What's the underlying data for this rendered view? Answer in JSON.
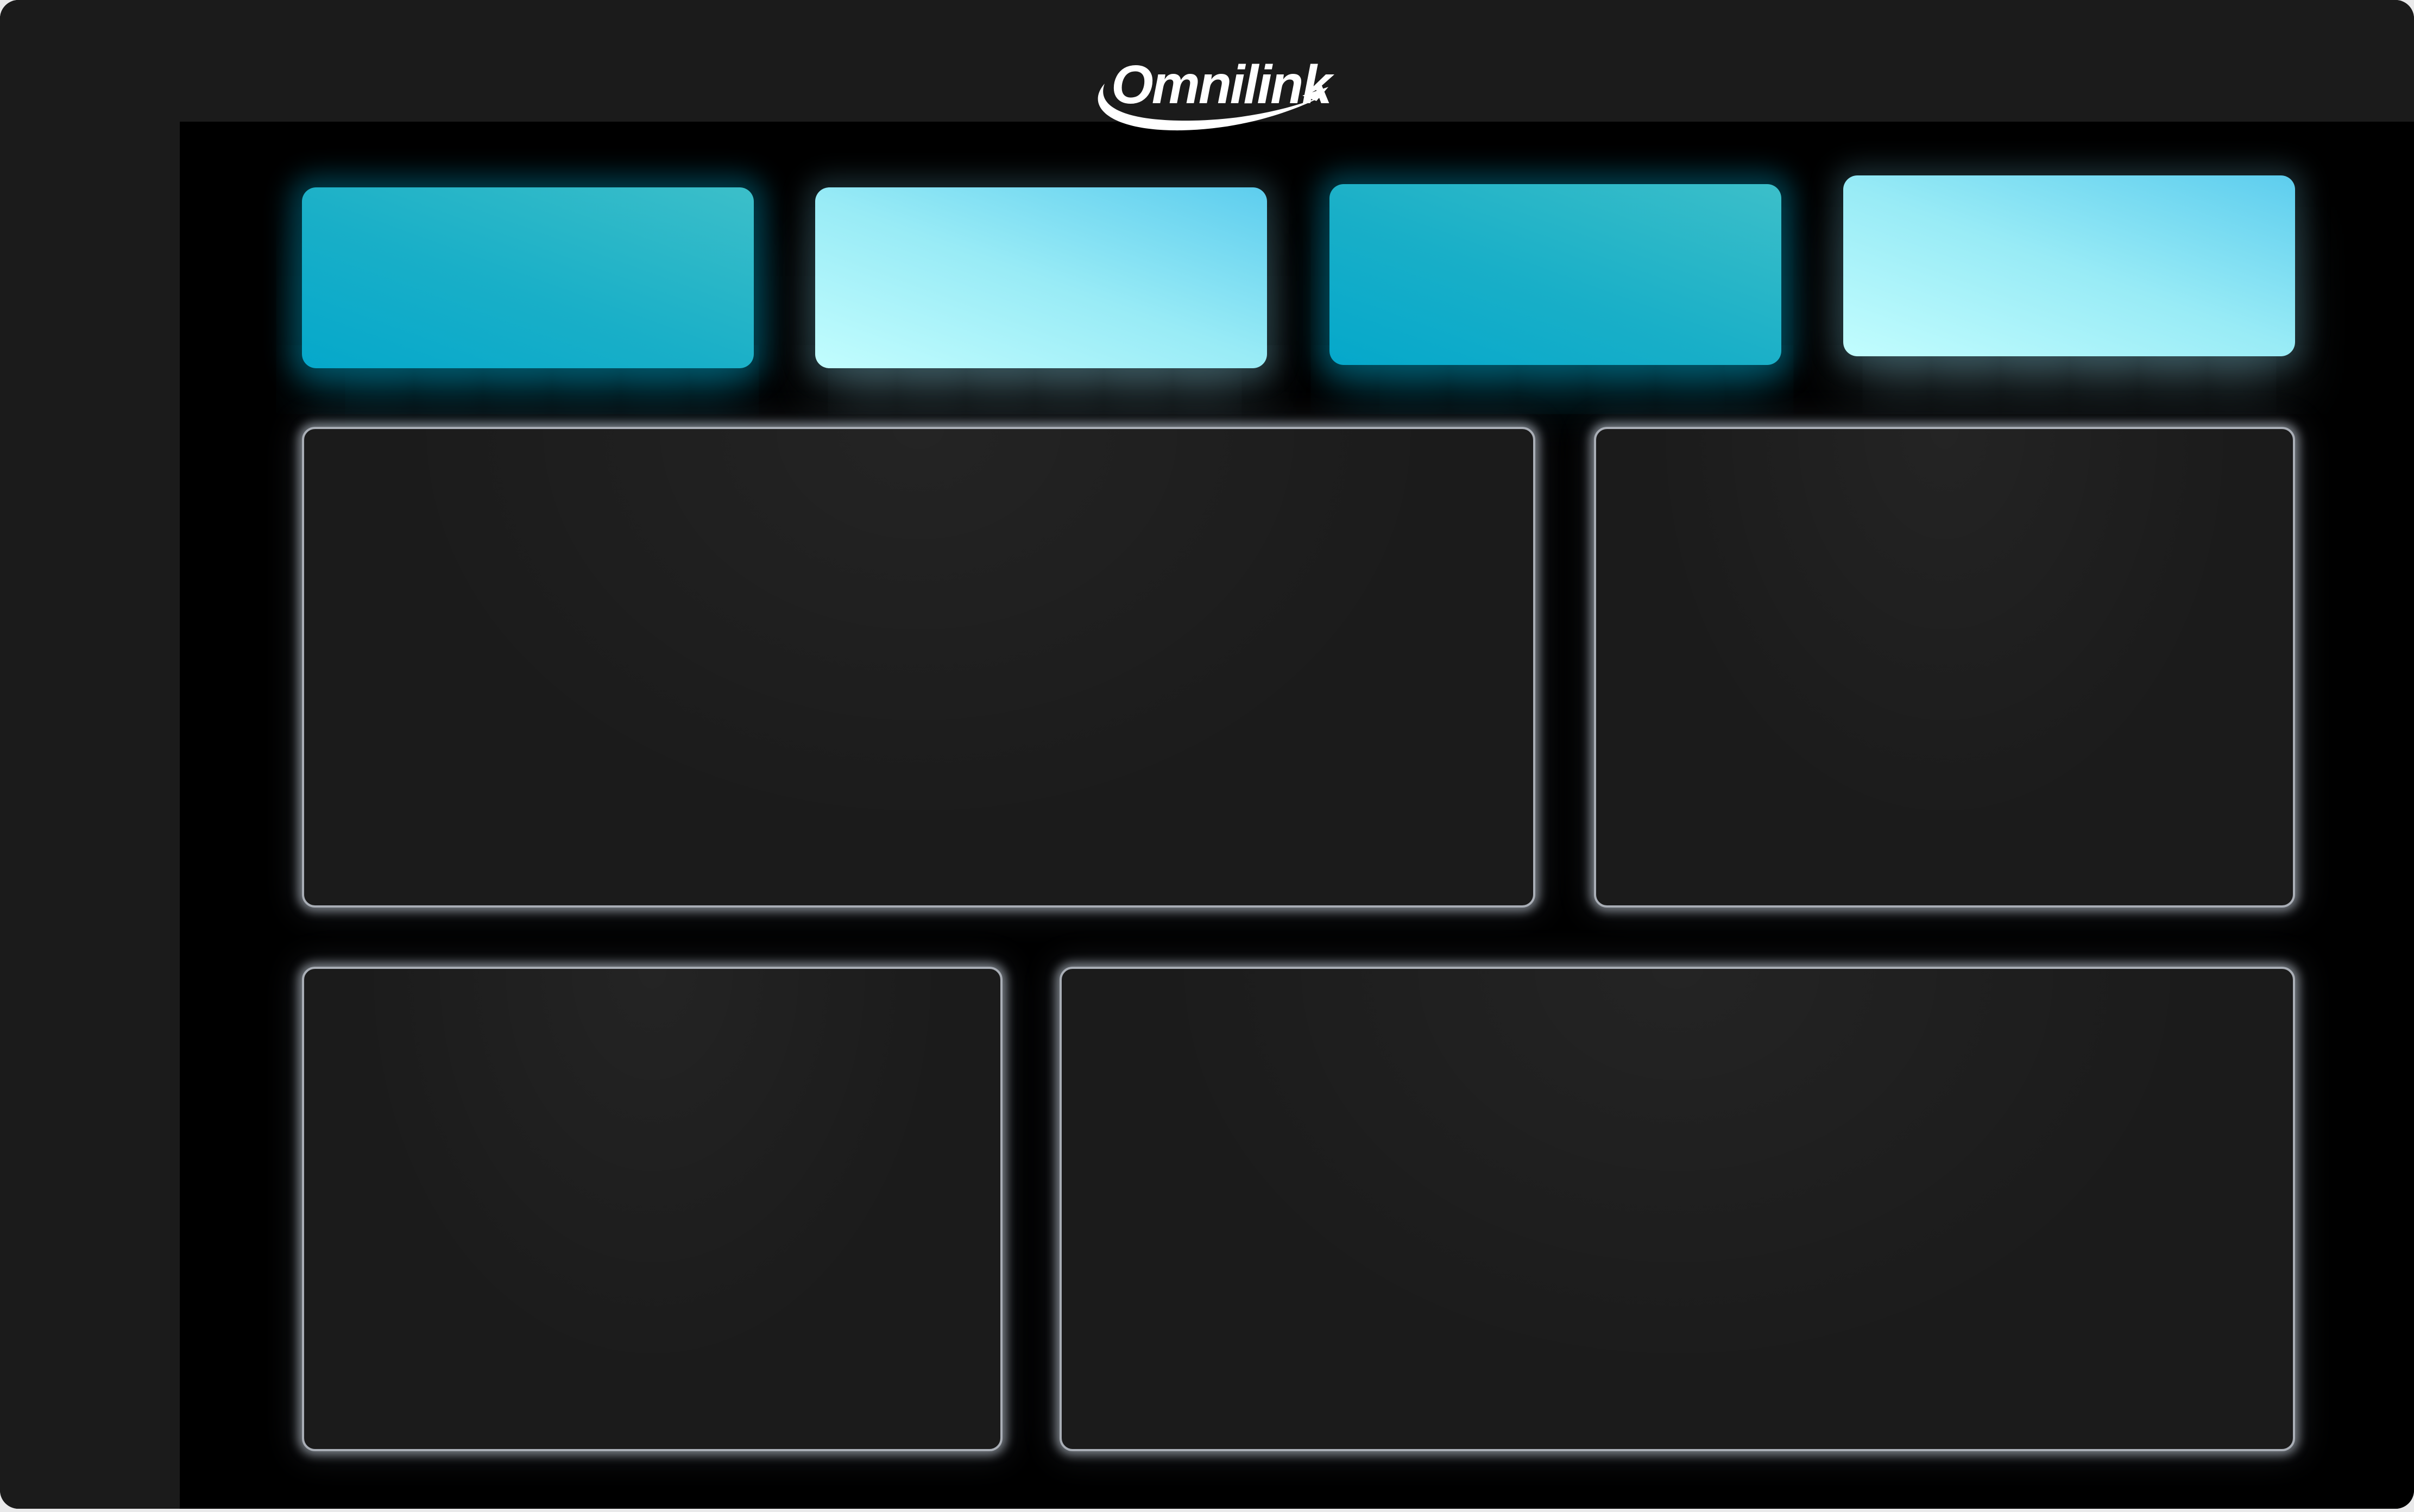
{
  "app": {
    "brand_name": "Omnilink"
  },
  "colors": {
    "frame": "#1b1b1b",
    "content_background": "#000000",
    "panel_background": "#1b1b1b",
    "panel_glow": "#d6deea",
    "kpi_teal_start": "#05a8cb",
    "kpi_teal_end": "#3cbfc9",
    "kpi_light_start": "#c2fdfe",
    "kpi_light_end": "#5dcdee",
    "logo": "#ffffff"
  },
  "icons": {
    "logo": "omnilink-swoosh-logo"
  },
  "kpi_cards": [
    {
      "style": "teal"
    },
    {
      "style": "light"
    },
    {
      "style": "teal"
    },
    {
      "style": "light"
    }
  ],
  "panels": [
    {
      "id": "panel-top-left"
    },
    {
      "id": "panel-top-right"
    },
    {
      "id": "panel-bottom-left"
    },
    {
      "id": "panel-bottom-right"
    }
  ]
}
